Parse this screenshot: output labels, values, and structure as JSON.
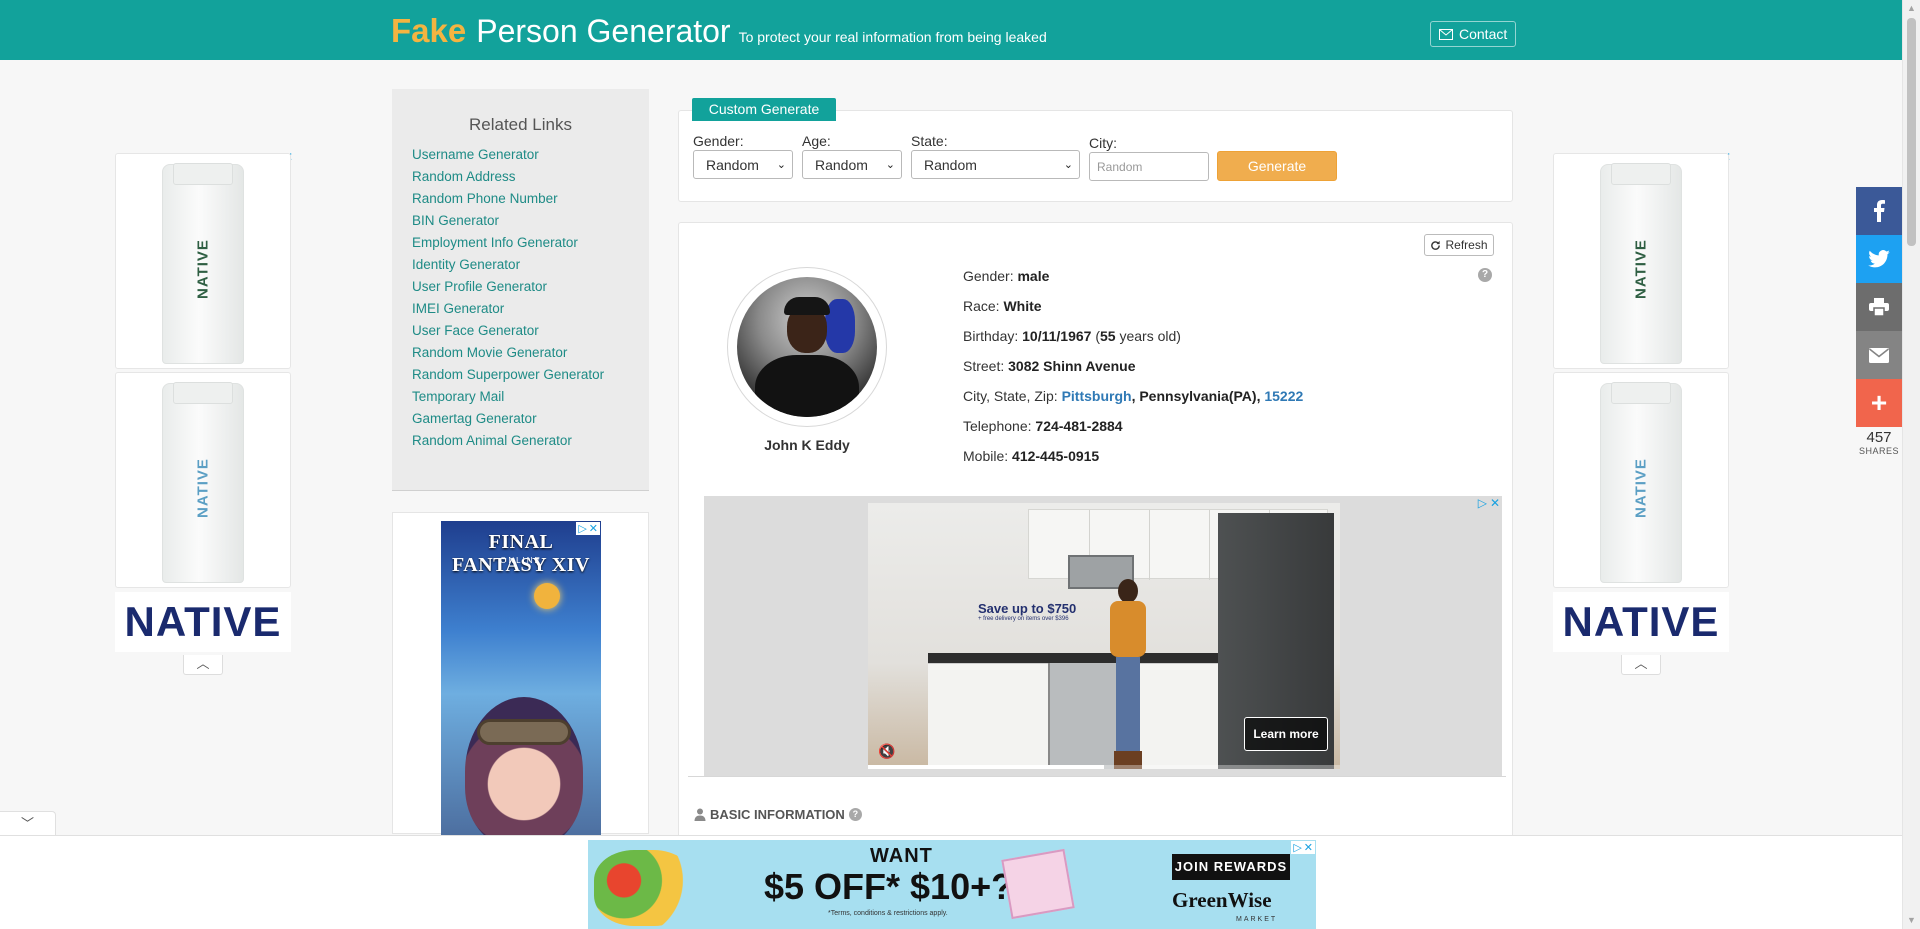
{
  "header": {
    "brand_fake": "Fake",
    "brand_rest": "Person Generator",
    "tagline": "To protect your real information from being leaked",
    "contact_label": "Contact"
  },
  "related_links": {
    "title": "Related Links",
    "items": [
      "Username Generator",
      "Random Address",
      "Random Phone Number",
      "BIN Generator",
      "Employment Info Generator",
      "Identity Generator",
      "User Profile Generator",
      "IMEI Generator",
      "User Face Generator",
      "Random Movie Generator",
      "Random Superpower Generator",
      "Temporary Mail",
      "Gamertag Generator",
      "Random Animal Generator"
    ]
  },
  "custom_generate": {
    "tab_label": "Custom Generate",
    "gender_label": "Gender:",
    "gender_value": "Random",
    "age_label": "Age:",
    "age_value": "Random",
    "state_label": "State:",
    "state_value": "Random",
    "city_label": "City:",
    "city_placeholder": "Random",
    "generate_label": "Generate"
  },
  "person": {
    "refresh_label": "Refresh",
    "name": "John K Eddy",
    "gender_label": "Gender:",
    "gender": "male",
    "race_label": "Race:",
    "race": "White",
    "birthday_label": "Birthday:",
    "birthday": "10/11/1967",
    "age": "55",
    "age_suffix": "years old",
    "street_label": "Street:",
    "street": "3082 Shinn Avenue",
    "csz_label": "City, State, Zip:",
    "city": "Pittsburgh",
    "state": "Pennsylvania(PA)",
    "zip": "15222",
    "telephone_label": "Telephone:",
    "telephone": "724-481-2884",
    "mobile_label": "Mobile:",
    "mobile": "412-445-0915"
  },
  "section": {
    "basic_information": "BASIC INFORMATION"
  },
  "ads": {
    "side_brand": "NATIVE",
    "ff_title": "FINAL FANTASY XIV",
    "ff_sub": "ONLINE",
    "video_promo": "Save up to $750",
    "video_promo_small": "+ free delivery on items over $396",
    "learn_more": "Learn more",
    "banner_want": "WANT",
    "banner_offer": "$5 OFF* $10+?",
    "banner_terms": "*Terms, conditions & restrictions apply.",
    "banner_join": "JOIN REWARDS",
    "banner_brand": "GreenWise",
    "banner_market": "MARKET"
  },
  "share": {
    "count": "457",
    "label": "SHARES"
  },
  "colors": {
    "brand_teal": "#12a29b",
    "brand_orange": "#f3b441",
    "generate_button": "#f0ad4e",
    "link_teal": "#1e8b86",
    "link_blue": "#2f79b5"
  }
}
